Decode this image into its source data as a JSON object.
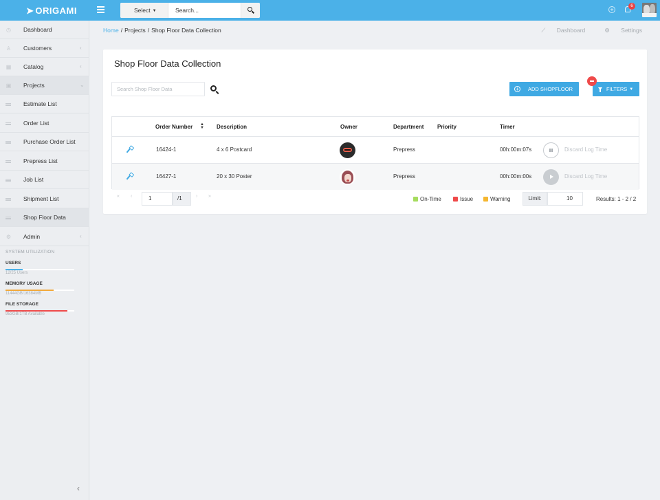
{
  "app": {
    "logo": "ORIGAMI"
  },
  "topbar": {
    "select_label": "Select",
    "search_placeholder": "Search...",
    "notification_count": "6"
  },
  "sidebar": {
    "items": [
      {
        "label": "Dashboard",
        "icon": "clock-icon"
      },
      {
        "label": "Customers",
        "icon": "user-icon",
        "chevron": "‹"
      },
      {
        "label": "Catalog",
        "icon": "grid-icon",
        "chevron": "‹"
      },
      {
        "label": "Projects",
        "icon": "briefcase-icon",
        "chevron": "⌄"
      },
      {
        "label": "Estimate List",
        "icon": "list-icon"
      },
      {
        "label": "Order List",
        "icon": "list-icon"
      },
      {
        "label": "Purchase Order List",
        "icon": "list-icon"
      },
      {
        "label": "Prepress List",
        "icon": "list-icon"
      },
      {
        "label": "Job List",
        "icon": "list-icon"
      },
      {
        "label": "Shipment List",
        "icon": "list-icon"
      },
      {
        "label": "Shop Floor Data",
        "icon": "list-icon"
      },
      {
        "label": "Admin",
        "icon": "gear-icon",
        "chevron": "‹"
      }
    ],
    "system_title": "SYSTEM UTILIZATION",
    "utilization": [
      {
        "title": "USERS",
        "detail": "12/25 Users",
        "fraction": 0.25,
        "color": "#4bb1e8"
      },
      {
        "title": "MEMORY USAGE",
        "detail": "11444GB/16384MB",
        "fraction": 0.7,
        "color": "#f2a93b"
      },
      {
        "title": "FILE STORAGE",
        "detail": "953GB/1TB Available",
        "fraction": 0.9,
        "color": "#ef4a4a"
      }
    ]
  },
  "breadcrumb": {
    "home": "Home",
    "projects": "Projects",
    "current": "Shop Floor Data Collection"
  },
  "header_links": {
    "dashboard": "Dashboard",
    "settings": "Settings"
  },
  "main": {
    "title": "Shop Floor Data Collection",
    "search_placeholder": "Search Shop Floor Data",
    "add_button": "ADD SHOPFLOOR",
    "filters_button": "FILTERS"
  },
  "table": {
    "headers": {
      "order_number": "Order Number",
      "description": "Description",
      "owner": "Owner",
      "department": "Department",
      "priority": "Priority",
      "timer": "Timer"
    },
    "rows": [
      {
        "order_number": "16424-1",
        "description": "4 x 6 Postcard",
        "department": "Prepress",
        "priority": "",
        "timer": "00h:00m:07s",
        "discard": "Discard Log Time"
      },
      {
        "order_number": "16427-1",
        "description": "20 x 30 Poster",
        "department": "Prepress",
        "priority": "",
        "timer": "00h:00m:00s",
        "discard": "Discard Log Time"
      }
    ]
  },
  "footer": {
    "page": "1",
    "page_total": "/1",
    "legend": [
      {
        "label": "On-Time",
        "color": "#a6dc5e"
      },
      {
        "label": "Issue",
        "color": "#ef4a4a"
      },
      {
        "label": "Warning",
        "color": "#f5b731"
      }
    ],
    "limit_label": "Limit:",
    "limit_value": "10",
    "results": "Results: 1 - 2 / 2"
  }
}
